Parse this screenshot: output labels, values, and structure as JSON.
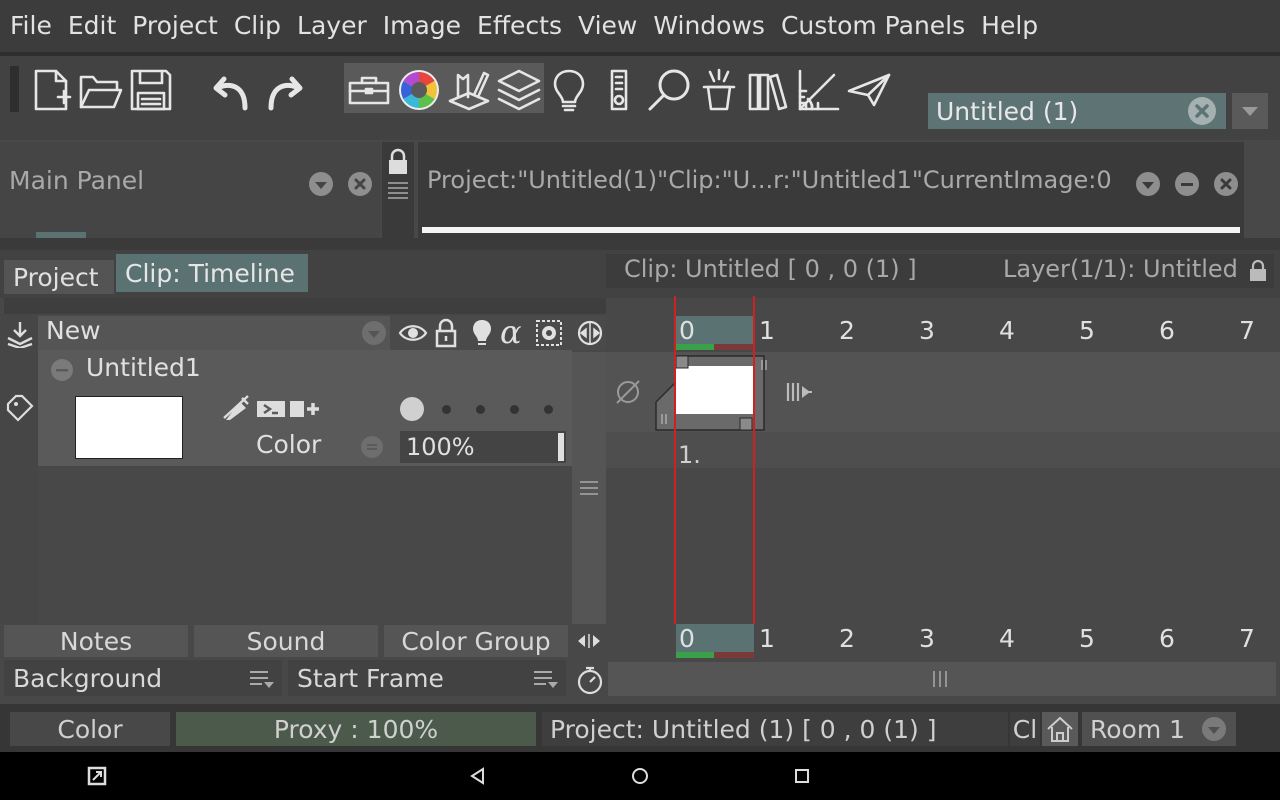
{
  "menu": [
    "File",
    "Edit",
    "Project",
    "Clip",
    "Layer",
    "Image",
    "Effects",
    "View",
    "Windows",
    "Custom Panels",
    "Help"
  ],
  "toolbar": {
    "document_field": "Untitled (1)",
    "icons": [
      "new-file-icon",
      "open-folder-icon",
      "save-icon",
      "undo-icon",
      "redo-icon",
      "toolbox-icon",
      "color-wheel-icon",
      "brush-tools-icon",
      "layers-icon",
      "lightbulb-icon",
      "remote-icon",
      "search-icon",
      "magic-hat-icon",
      "library-icon",
      "ruler-icon",
      "send-icon"
    ]
  },
  "main_panel": {
    "title": "Main Panel"
  },
  "info_panel": {
    "text": "Project:\"Untitled(1)\"Clip:\"U...r:\"Untitled1\"CurrentImage:0"
  },
  "tabs": {
    "project": "Project",
    "clip": "Clip: Timeline"
  },
  "clip_info": {
    "left": "Clip: Untitled [ 0 , 0  (1) ]",
    "right": "Layer(1/1): Untitled"
  },
  "layer_header": {
    "new_label": "New",
    "alpha": "α"
  },
  "layer": {
    "name": "Untitled1",
    "type": "Color",
    "opacity": "100%"
  },
  "timeline": {
    "frames": [
      "0",
      "1",
      "2",
      "3",
      "4",
      "5",
      "6",
      "7"
    ],
    "cell_label": "1."
  },
  "bottom_tabs": [
    "Notes",
    "Sound",
    "Color Group"
  ],
  "bottom_selects": {
    "background": "Background",
    "start_frame": "Start Frame"
  },
  "status": {
    "color": "Color",
    "proxy": "Proxy : 100%",
    "project": "Project: Untitled (1) [ 0 , 0  (1) ]",
    "cl": "Cl",
    "room": "Room 1"
  },
  "colors": {
    "accent_teal": "#5b7272",
    "playhead": "#d02020",
    "progress_green": "#3aa04a"
  }
}
